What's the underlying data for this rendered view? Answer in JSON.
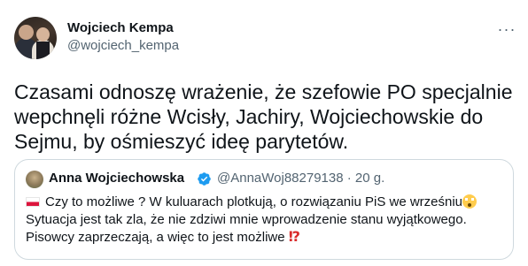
{
  "tweet": {
    "author_name": "Wojciech Kempa",
    "author_handle": "@wojciech_kempa",
    "more_icon": "···",
    "text_lines": [
      "Czasami odnoszę wrażenie, że szefowie PO specjalnie",
      "wepchnęli różne Wcisły, Jachiry, Wojciechowskie do",
      "Sejmu, by ośmieszyć ideę parytetów."
    ]
  },
  "quote": {
    "author_name": "Anna Wojciechowska",
    "verified_icon": "verified-badge-icon",
    "handle_time": "@AnnaWoj88279138 · 20 g.",
    "lines": [
      "Czy to możliwe ?  W kuluarach plotkują, o rozwiązaniu PiS  we wrześniu",
      "Sytuacja jest tak zla, że nie zdziwi mnie wprowadzenie stanu wyjątkowego.",
      "Pisowcy zaprzeczają, a więc to jest możliwe "
    ],
    "exclamation_question": "⁉"
  },
  "colors": {
    "text_primary": "#0f1419",
    "text_secondary": "#536471",
    "border": "#cfd9de",
    "verified": "#1d9bf0"
  }
}
